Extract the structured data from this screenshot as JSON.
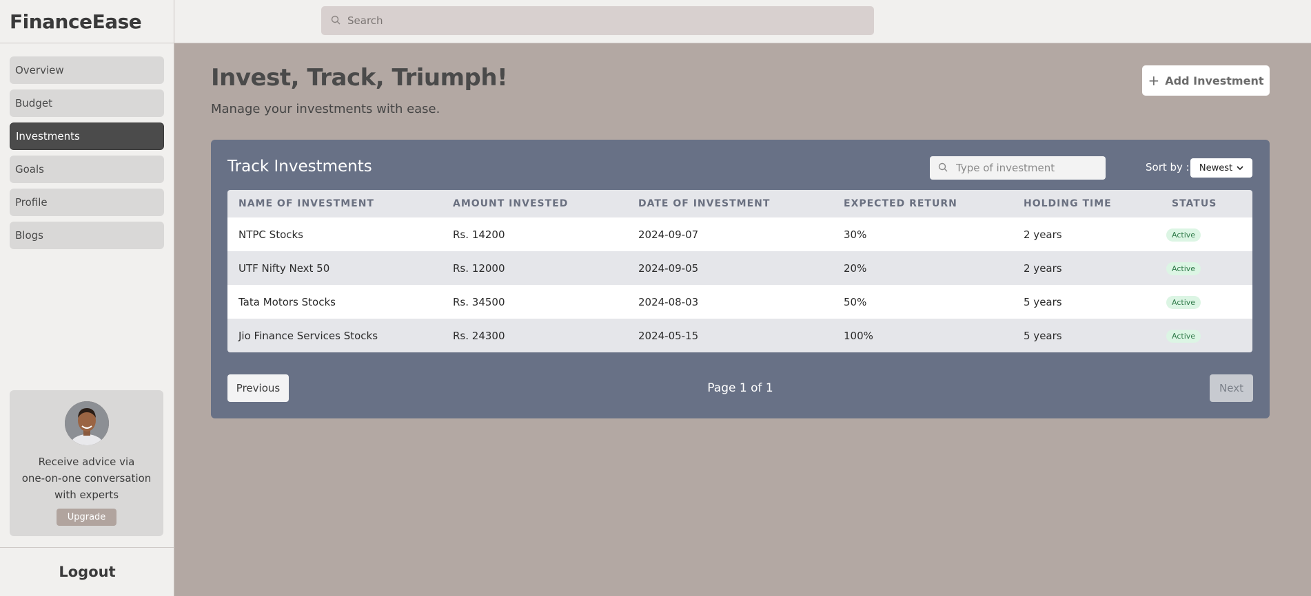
{
  "app": {
    "brand": "FinanceEase"
  },
  "sidebar": {
    "items": [
      {
        "label": "Overview",
        "active": false
      },
      {
        "label": "Budget",
        "active": false
      },
      {
        "label": "Investments",
        "active": true
      },
      {
        "label": "Goals",
        "active": false
      },
      {
        "label": "Profile",
        "active": false
      },
      {
        "label": "Blogs",
        "active": false
      }
    ],
    "promo": {
      "text_line1": "Receive advice via",
      "text_line2": "one-on-one conversation",
      "text_line3": "with experts",
      "button_label": "Upgrade"
    },
    "logout_label": "Logout"
  },
  "topbar": {
    "search_placeholder": "Search"
  },
  "main": {
    "title": "Invest, Track, Triumph!",
    "subtitle": "Manage your investments with ease.",
    "add_button_label": "Add Investment",
    "panel": {
      "title": "Track Investments",
      "filter_placeholder": "Type of investment",
      "sort_label": "Sort by :",
      "sort_value": "Newest",
      "columns": [
        "NAME OF INVESTMENT",
        "AMOUNT INVESTED",
        "DATE OF INVESTMENT",
        "EXPECTED RETURN",
        "HOLDING TIME",
        "STATUS"
      ],
      "rows": [
        {
          "name": "NTPC Stocks",
          "amount": "Rs. 14200",
          "date": "2024-09-07",
          "return": "30%",
          "holding": "2 years",
          "status": "Active"
        },
        {
          "name": "UTF Nifty Next 50",
          "amount": "Rs. 12000",
          "date": "2024-09-05",
          "return": "20%",
          "holding": "2 years",
          "status": "Active"
        },
        {
          "name": "Tata Motors Stocks",
          "amount": "Rs. 34500",
          "date": "2024-08-03",
          "return": "50%",
          "holding": "5 years",
          "status": "Active"
        },
        {
          "name": "Jio Finance Services Stocks",
          "amount": "Rs. 24300",
          "date": "2024-05-15",
          "return": "100%",
          "holding": "5 years",
          "status": "Active"
        }
      ],
      "pagination": {
        "previous_label": "Previous",
        "page_info": "Page 1 of 1",
        "next_label": "Next"
      }
    }
  },
  "colors": {
    "active_nav": "#4b4b4b",
    "panel": "#687186",
    "status_active_bg": "#dcf5e4",
    "status_active_text": "#2f7a49"
  },
  "icons": {
    "search": "search-icon",
    "plus": "plus-icon",
    "chevron": "chevron-down-icon"
  }
}
